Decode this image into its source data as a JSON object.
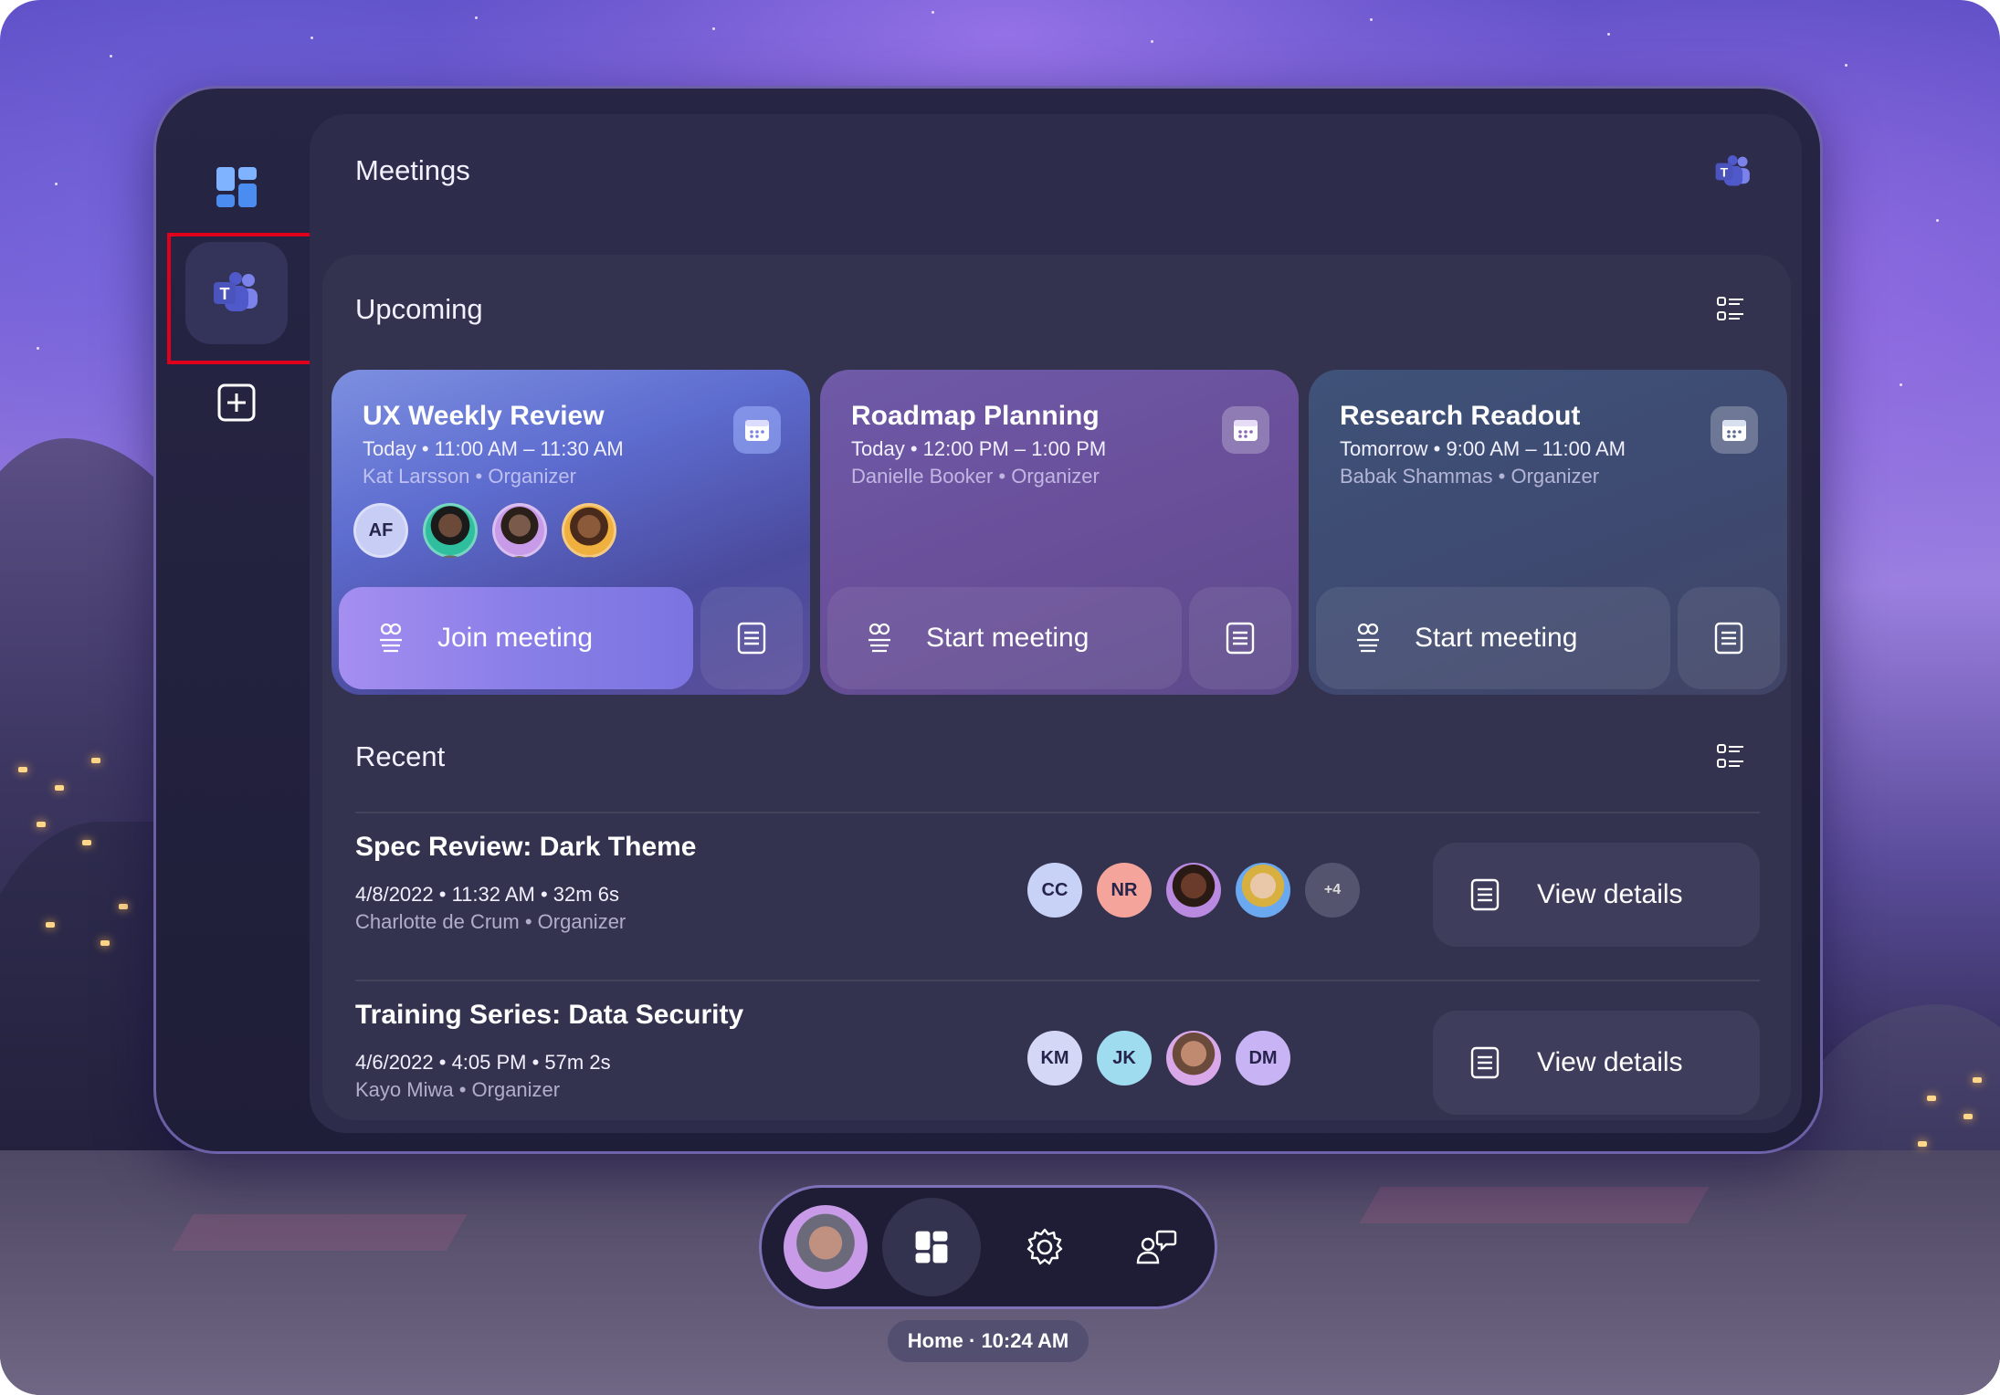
{
  "window": {
    "title": "Meetings"
  },
  "rail": {
    "items": [
      {
        "name": "dashboard",
        "icon": "dashboard-icon"
      },
      {
        "name": "teams",
        "icon": "teams-icon",
        "active": true
      },
      {
        "name": "add",
        "icon": "add-app-icon"
      }
    ]
  },
  "upcoming": {
    "title": "Upcoming",
    "cards": [
      {
        "title": "UX Weekly Review",
        "time": "Today • 11:00 AM – 11:30 AM",
        "organizer": "Kat Larsson • Organizer",
        "action": "Join meeting",
        "attendees": [
          "AF"
        ]
      },
      {
        "title": "Roadmap Planning",
        "time": "Today • 12:00 PM – 1:00 PM",
        "organizer": "Danielle Booker • Organizer",
        "action": "Start meeting"
      },
      {
        "title": "Research Readout",
        "time": "Tomorrow • 9:00 AM – 11:00 AM",
        "organizer": "Babak Shammas • Organizer",
        "action": "Start meeting"
      }
    ]
  },
  "recent": {
    "title": "Recent",
    "rows": [
      {
        "title": "Spec Review: Dark Theme",
        "meta": "4/8/2022 • 11:32 AM • 32m 6s",
        "organizer": "Charlotte de Crum • Organizer",
        "attendees": [
          "CC",
          "NR"
        ],
        "more": "+4",
        "action": "View details"
      },
      {
        "title": "Training Series: Data Security",
        "meta": "4/6/2022 • 4:05 PM • 57m 2s",
        "organizer": "Kayo Miwa • Organizer",
        "attendees": [
          "KM",
          "JK",
          "DM"
        ],
        "action": "View details"
      }
    ]
  },
  "dock": {
    "status": "Home · 10:24 AM"
  },
  "colors": {
    "accent": "#8a7fe8",
    "highlight": "#e1001c",
    "panel": "#2d2c4a"
  }
}
